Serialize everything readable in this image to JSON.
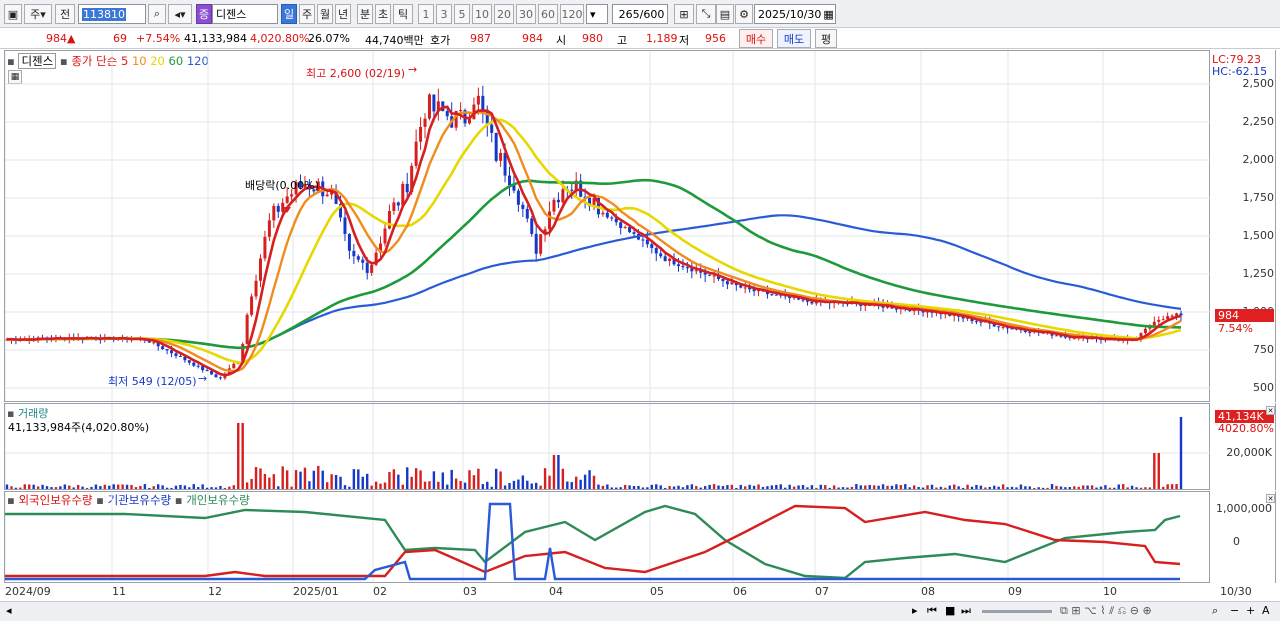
{
  "toolbar": {
    "chart_type": "주",
    "range_toggle": "전",
    "code": "113810",
    "stock_badge": "증",
    "stock_name": "디젠스",
    "periods": [
      "일",
      "주",
      "월",
      "년",
      "분",
      "초",
      "틱"
    ],
    "active_period": "일",
    "intervals": [
      "1",
      "3",
      "5",
      "10",
      "20",
      "30",
      "60",
      "120"
    ],
    "count": "265",
    "count_total": "/600",
    "date": "2025/10/30"
  },
  "quote": {
    "price": "984",
    "change_arrow": "▲",
    "change": "69",
    "change_pct": "+7.54%",
    "volume": "41,133,984",
    "volume_ratio": "4,020.80%",
    "turnover": "26.07%",
    "amount": "44,740백만",
    "hoga_label": "호가",
    "hoga_ask": "987",
    "hoga_bid": "984",
    "open_label": "시",
    "open": "980",
    "high_label": "고",
    "high": "1,189",
    "low_label": "저",
    "low": "956",
    "buy_label": "매수",
    "sell_label": "매도",
    "eval_label": "평"
  },
  "price_panel": {
    "stock_name": "디젠스",
    "ma_legend_prefix": "종가 단순",
    "ma_periods": [
      {
        "label": "5",
        "color": "#d61f1f"
      },
      {
        "label": "10",
        "color": "#f08c1e"
      },
      {
        "label": "20",
        "color": "#e6d800"
      },
      {
        "label": "60",
        "color": "#1f9a3a"
      },
      {
        "label": "120",
        "color": "#2a5bd7"
      }
    ],
    "high_annotation": "최고 2,600 (02/19)",
    "low_annotation": "최저 549 (12/05)",
    "dividend_annotation": "배당락(0.00%)",
    "lc": "LC:79.23",
    "hc": "HC:-62.15",
    "y_ticks": [
      "2,500",
      "2,250",
      "2,000",
      "1,750",
      "1,500",
      "1,250",
      "1,000",
      "750",
      "500"
    ],
    "y_tick_values": [
      2500,
      2250,
      2000,
      1750,
      1500,
      1250,
      1000,
      750,
      500
    ],
    "current_tag": "984",
    "current_pct": "7.54%"
  },
  "volume_panel": {
    "title": "거래량",
    "summary": "41,133,984주(4,020.80%)",
    "tag": "41,134K",
    "tag_pct": "4020.80%",
    "y_tick": "20,000K"
  },
  "holding_panel": {
    "legend": [
      "외국인보유수량",
      "기관보유수량",
      "개인보유수량"
    ],
    "colors": [
      "#d61f1f",
      "#2a5bd7",
      "#2e8b57"
    ],
    "y_ticks": [
      "1,000,000",
      "0"
    ]
  },
  "x_axis": [
    "2024/09",
    "11",
    "12",
    "2025/01",
    "02",
    "03",
    "04",
    "05",
    "06",
    "07",
    "08",
    "09",
    "10",
    "10/30"
  ],
  "colors": {
    "up": "#d61f1f",
    "down": "#1438c8",
    "accent": "#3b77d6"
  }
}
